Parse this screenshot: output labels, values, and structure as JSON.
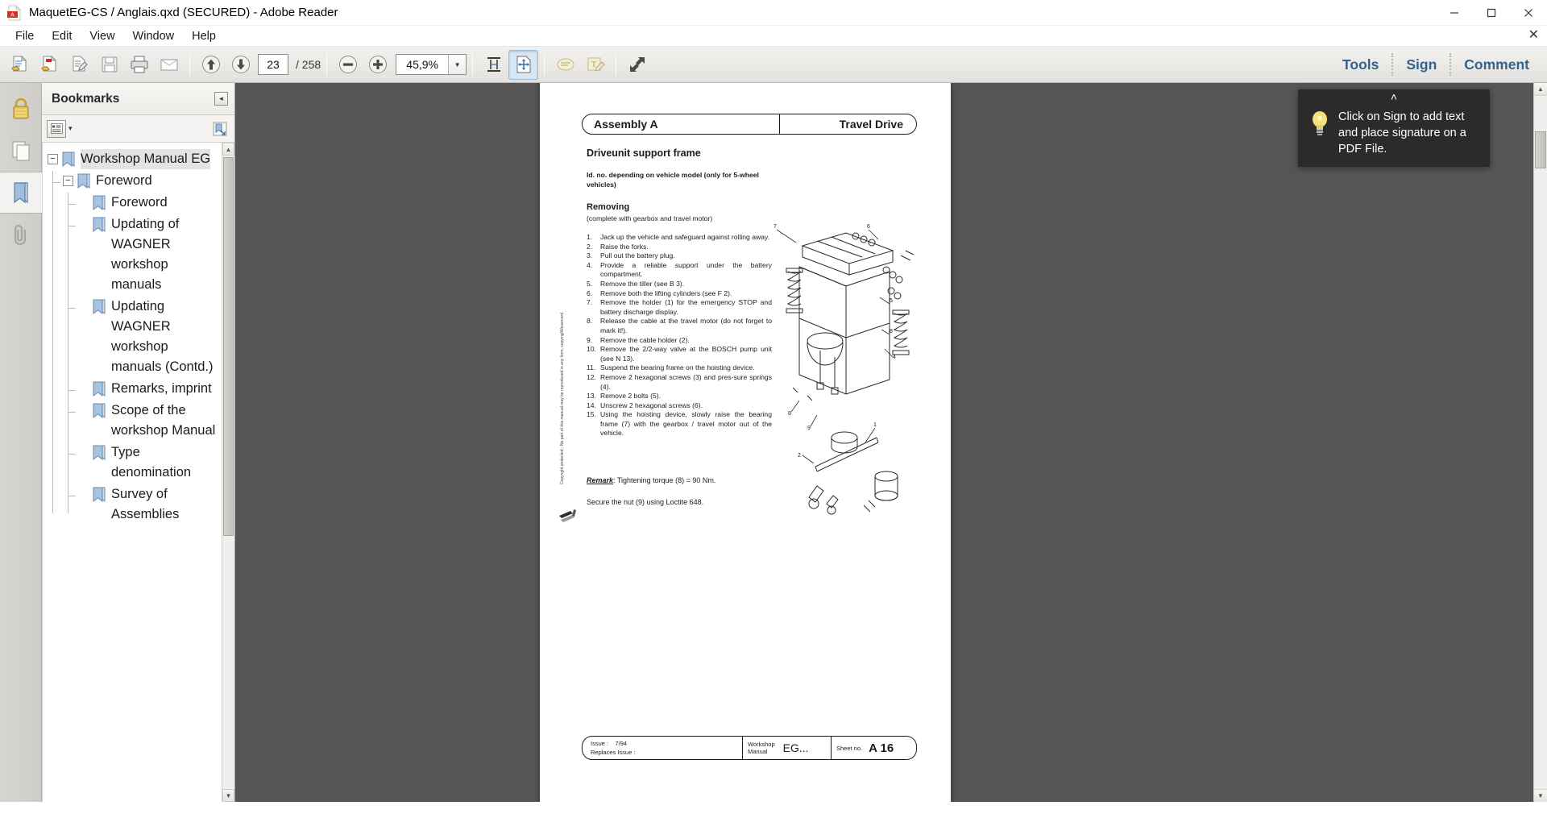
{
  "window": {
    "title": "MaquetEG-CS / Anglais.qxd (SECURED) - Adobe Reader",
    "app_icon": "pdf-file-icon",
    "minimize_label": "Minimize",
    "maximize_label": "Restore",
    "close_label": "Close"
  },
  "menubar": {
    "items": [
      {
        "label": "File"
      },
      {
        "label": "Edit"
      },
      {
        "label": "View"
      },
      {
        "label": "Window"
      },
      {
        "label": "Help"
      }
    ],
    "close_doc_label": "✕"
  },
  "toolbar": {
    "buttons": [
      {
        "name": "open-file-button",
        "icon": "open-document-icon"
      },
      {
        "name": "create-pdf-button",
        "icon": "create-pdf-icon"
      },
      {
        "name": "edit-pdf-button",
        "icon": "edit-pdf-icon"
      },
      {
        "name": "save-button",
        "icon": "floppy-disk-icon"
      },
      {
        "name": "print-button",
        "icon": "printer-icon"
      },
      {
        "name": "email-button",
        "icon": "envelope-icon"
      }
    ],
    "prev_page_label": "Previous Page",
    "next_page_label": "Next Page",
    "page_number": "23",
    "page_total": "/ 258",
    "zoom_out_label": "Zoom Out",
    "zoom_in_label": "Zoom In",
    "zoom_value": "45,9%",
    "zoom_dropdown_caret": "▼",
    "fit_width_label": "Fit Width",
    "fit_page_label": "Fit Page",
    "comment_tool_label": "Add Sticky Note",
    "text_tool_label": "Highlight Text",
    "read_mode_label": "Read Mode",
    "links": [
      {
        "label": "Tools",
        "name": "tools-link"
      },
      {
        "label": "Sign",
        "name": "sign-link"
      },
      {
        "label": "Comment",
        "name": "comment-link"
      }
    ],
    "link_color": "#33628f"
  },
  "rail": {
    "items": [
      {
        "name": "sidebar-icon-security",
        "icon": "lock-icon",
        "active": false
      },
      {
        "name": "sidebar-icon-page-thumbnails",
        "icon": "pages-icon",
        "active": false
      },
      {
        "name": "sidebar-icon-bookmarks",
        "icon": "bookmark-icon",
        "active": true
      },
      {
        "name": "sidebar-icon-attachments",
        "icon": "paperclip-icon",
        "active": false
      }
    ]
  },
  "bookmarks": {
    "title": "Bookmarks",
    "collapse_label": "◂",
    "options_icon": "list-options-icon",
    "options_caret": "▾",
    "expand_current_icon": "expand-bookmark-icon",
    "tree": {
      "label": "Workshop Manual EG",
      "expander": "−",
      "selected": true,
      "children": [
        {
          "label": "Foreword",
          "expander": "−",
          "children": [
            {
              "label": "Foreword"
            },
            {
              "label": "Updating of WAGNER workshop manuals"
            },
            {
              "label": "Updating WAGNER workshop manuals (Contd.)"
            },
            {
              "label": "Remarks, imprint"
            },
            {
              "label": "Scope of the workshop Manual"
            },
            {
              "label": "Type denomination"
            },
            {
              "label": "Survey of Assemblies"
            }
          ]
        }
      ]
    },
    "scroll_up": "▲",
    "scroll_down": "▼"
  },
  "document": {
    "header_left": "Assembly A",
    "header_right": "Travel Drive",
    "heading": "Driveunit support frame",
    "subheading": "Id. no. depending on vehicle model (only for 5-wheel vehicles)",
    "section_title": "Removing",
    "section_subtitle": "(complete with gearbox and travel motor)",
    "steps": [
      {
        "num": "1.",
        "text": "Jack up the vehicle and safeguard against rolling away."
      },
      {
        "num": "2.",
        "text": "Raise the forks."
      },
      {
        "num": "3.",
        "text": "Pull out the battery plug."
      },
      {
        "num": "4.",
        "text": "Provide a reliable support under the battery compartment."
      },
      {
        "num": "5.",
        "text": "Remove the tiller (see B 3)."
      },
      {
        "num": "6.",
        "text": "Remove both the lifting cylinders (see F 2)."
      },
      {
        "num": "7.",
        "text": "Remove the holder (1) for the emergency STOP and battery discharge display."
      },
      {
        "num": "8.",
        "text": "Release the cable at the travel motor (do not forget to mark it!)."
      },
      {
        "num": "9.",
        "text": "Remove the cable holder (2)."
      },
      {
        "num": "10.",
        "text": "Remove the 2/2-way valve at the BOSCH pump unit (see N 13)."
      },
      {
        "num": "11.",
        "text": "Suspend the bearing frame on the hoisting device."
      },
      {
        "num": "12.",
        "text": "Remove 2 hexagonal screws (3) and pres-sure springs (4)."
      },
      {
        "num": "13.",
        "text": "Remove 2 bolts (5)."
      },
      {
        "num": "14.",
        "text": "Unscrew 2 hexagonal screws (6)."
      },
      {
        "num": "15.",
        "text": "Using the hoisting device, slowly raise the bearing frame (7) with the gearbox / travel motor out of the vehicle."
      }
    ],
    "remark_label": "Remark",
    "remark_text": ": Tightening torque (8) = 90 Nm.",
    "secure_text": "Secure the nut (9) using Loctite 648.",
    "copyright_note": "Copyright protected - No part of this manual may be reproduced in any form, copying/Wesercord",
    "figure_top_labels": [
      "7",
      "6",
      "5",
      "4",
      "8",
      "9",
      "8"
    ],
    "figure_bottom_labels": [
      "1",
      "2"
    ],
    "footer": {
      "issue_label": "Issue :",
      "issue_value": "7/94",
      "replaces_label": "Replaces Issue :",
      "manual_label_line1": "Workshop",
      "manual_label_line2": "Manual",
      "manual_value": "EG...",
      "sheet_label": "Sheet no.",
      "sheet_value": "A 16"
    }
  },
  "sign_tooltip": {
    "caret": "˄",
    "icon": "lightbulb-icon",
    "text": "Click on Sign to add text and place signature on a PDF File."
  }
}
